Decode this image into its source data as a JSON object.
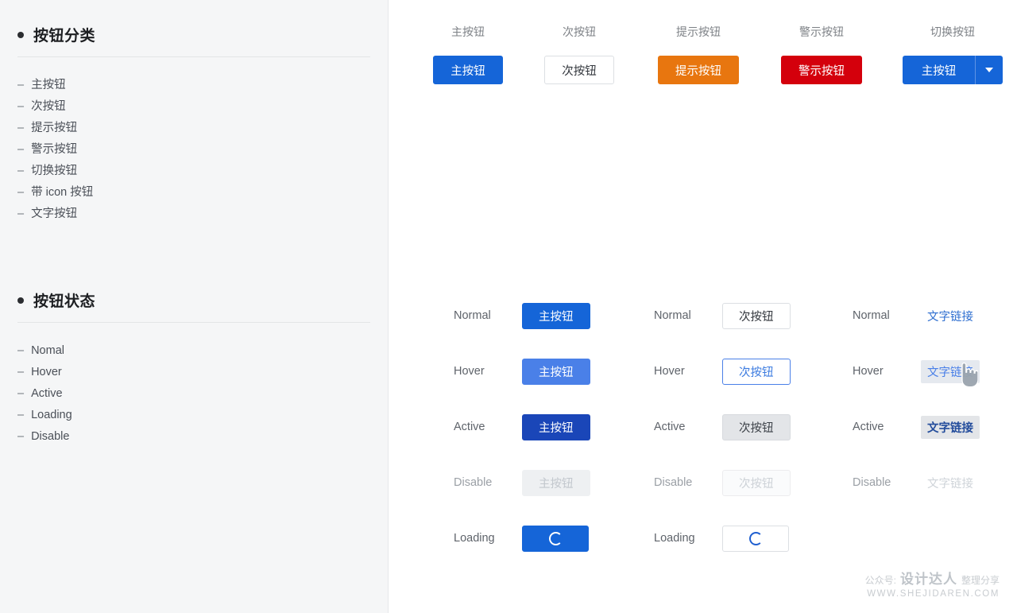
{
  "sidebar": {
    "sections": [
      {
        "title": "按钮分类",
        "items": [
          "主按钮",
          "次按钮",
          "提示按钮",
          "警示按钮",
          "切换按钮",
          "带 icon 按钮",
          "文字按钮"
        ]
      },
      {
        "title": "按钮状态",
        "items": [
          "Nomal",
          "Hover",
          "Active",
          "Loading",
          "Disable"
        ]
      }
    ],
    "dash": "–"
  },
  "types_row": [
    {
      "label": "主按钮",
      "button_text": "主按钮",
      "variant": "primary"
    },
    {
      "label": "次按钮",
      "button_text": "次按钮",
      "variant": "secondary"
    },
    {
      "label": "提示按钮",
      "button_text": "提示按钮",
      "variant": "warning"
    },
    {
      "label": "警示按钮",
      "button_text": "警示按钮",
      "variant": "danger"
    },
    {
      "label": "切换按钮",
      "button_text": "主按钮",
      "variant": "split",
      "caret": "chevron-down-icon"
    }
  ],
  "matrix": {
    "primary": {
      "rows": [
        {
          "state": "Normal",
          "text": "主按钮"
        },
        {
          "state": "Hover",
          "text": "主按钮"
        },
        {
          "state": "Active",
          "text": "主按钮"
        },
        {
          "state": "Disable",
          "text": "主按钮"
        },
        {
          "state": "Loading",
          "text": ""
        }
      ]
    },
    "secondary": {
      "rows": [
        {
          "state": "Normal",
          "text": "次按钮"
        },
        {
          "state": "Hover",
          "text": "次按钮"
        },
        {
          "state": "Active",
          "text": "次按钮"
        },
        {
          "state": "Disable",
          "text": "次按钮"
        },
        {
          "state": "Loading",
          "text": ""
        }
      ]
    },
    "link": {
      "rows": [
        {
          "state": "Normal",
          "text": "文字链接"
        },
        {
          "state": "Hover",
          "text": "文字链接"
        },
        {
          "state": "Active",
          "text": "文字链接"
        },
        {
          "state": "Disable",
          "text": "文字链接"
        }
      ]
    }
  },
  "watermark": {
    "prefix": "公众号:",
    "brand": "设计达人",
    "suffix": "整理分享",
    "url": "WWW.SHEJIDAREN.COM"
  },
  "colors": {
    "primary": "#1565d8",
    "primary_hover": "#4a80e8",
    "primary_active": "#1a46b8",
    "warning": "#e8760f",
    "danger": "#d4000c",
    "link": "#2f6fd0",
    "sidebar_bg": "#f5f6f7"
  }
}
